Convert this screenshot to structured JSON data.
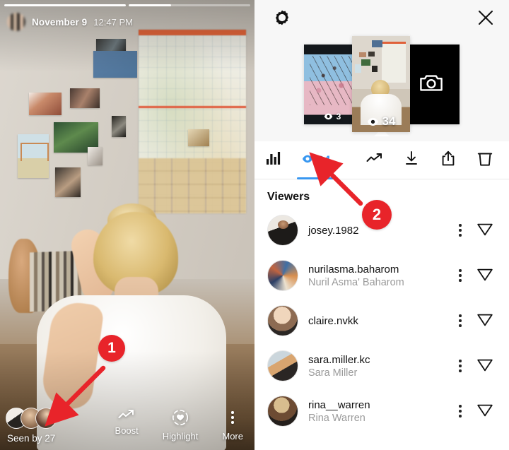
{
  "story": {
    "progress": {
      "segments": [
        100,
        35
      ]
    },
    "header": {
      "avatar_icon": "user-avatar-blurred",
      "date": "November 9",
      "time": "12:47 PM"
    },
    "footer": {
      "seen_by_label": "Seen by 27",
      "viewer_avatars": [
        "viewer-avatar-1",
        "viewer-avatar-2",
        "viewer-avatar-3"
      ],
      "actions": [
        {
          "label": "Boost",
          "icon": "trending-arrow-icon"
        },
        {
          "label": "Highlight",
          "icon": "highlight-heart-icon"
        },
        {
          "label": "More",
          "icon": "more-vertical-dots-icon"
        }
      ]
    }
  },
  "insights": {
    "gear_icon": "settings-gear-icon",
    "close_icon": "close-x-icon",
    "thumbnails": [
      {
        "name": "previous-story-thumbnail",
        "views": "3",
        "selected": false,
        "type": "photo"
      },
      {
        "name": "current-story-thumbnail",
        "views": "34",
        "selected": true,
        "type": "photo"
      },
      {
        "name": "add-story-thumbnail",
        "views": "",
        "selected": false,
        "type": "camera"
      }
    ],
    "toolbar": {
      "insights_icon": "bar-chart-insights-icon",
      "views_icon": "eye-views-icon",
      "views_count": "34",
      "active_color": "#3897f0",
      "items": [
        {
          "name": "boost-trending-button",
          "icon": "trending-arrow-icon"
        },
        {
          "name": "download-button",
          "icon": "download-icon"
        },
        {
          "name": "share-button",
          "icon": "share-upload-icon"
        },
        {
          "name": "delete-button",
          "icon": "trash-icon"
        }
      ]
    },
    "viewers_heading": "Viewers",
    "viewers": [
      {
        "username": "josey.1982",
        "fullname": "",
        "avatar": "avatar-josey"
      },
      {
        "username": "nurilasma.baharom",
        "fullname": "Nuril Asma' Baharom",
        "avatar": "avatar-nurilasma"
      },
      {
        "username": "claire.nvkk",
        "fullname": "",
        "avatar": "avatar-claire"
      },
      {
        "username": "sara.miller.kc",
        "fullname": "Sara Miller",
        "avatar": "avatar-sara"
      },
      {
        "username": "rina__warren",
        "fullname": "Rina Warren",
        "avatar": "avatar-rina"
      }
    ],
    "row_icons": {
      "more": "more-vertical-dots-icon",
      "send": "send-message-icon"
    }
  },
  "annotations": {
    "color": "#e8242a",
    "markers": [
      {
        "label": "1",
        "target": "seen-by-avatars"
      },
      {
        "label": "2",
        "target": "views-tab"
      }
    ]
  }
}
